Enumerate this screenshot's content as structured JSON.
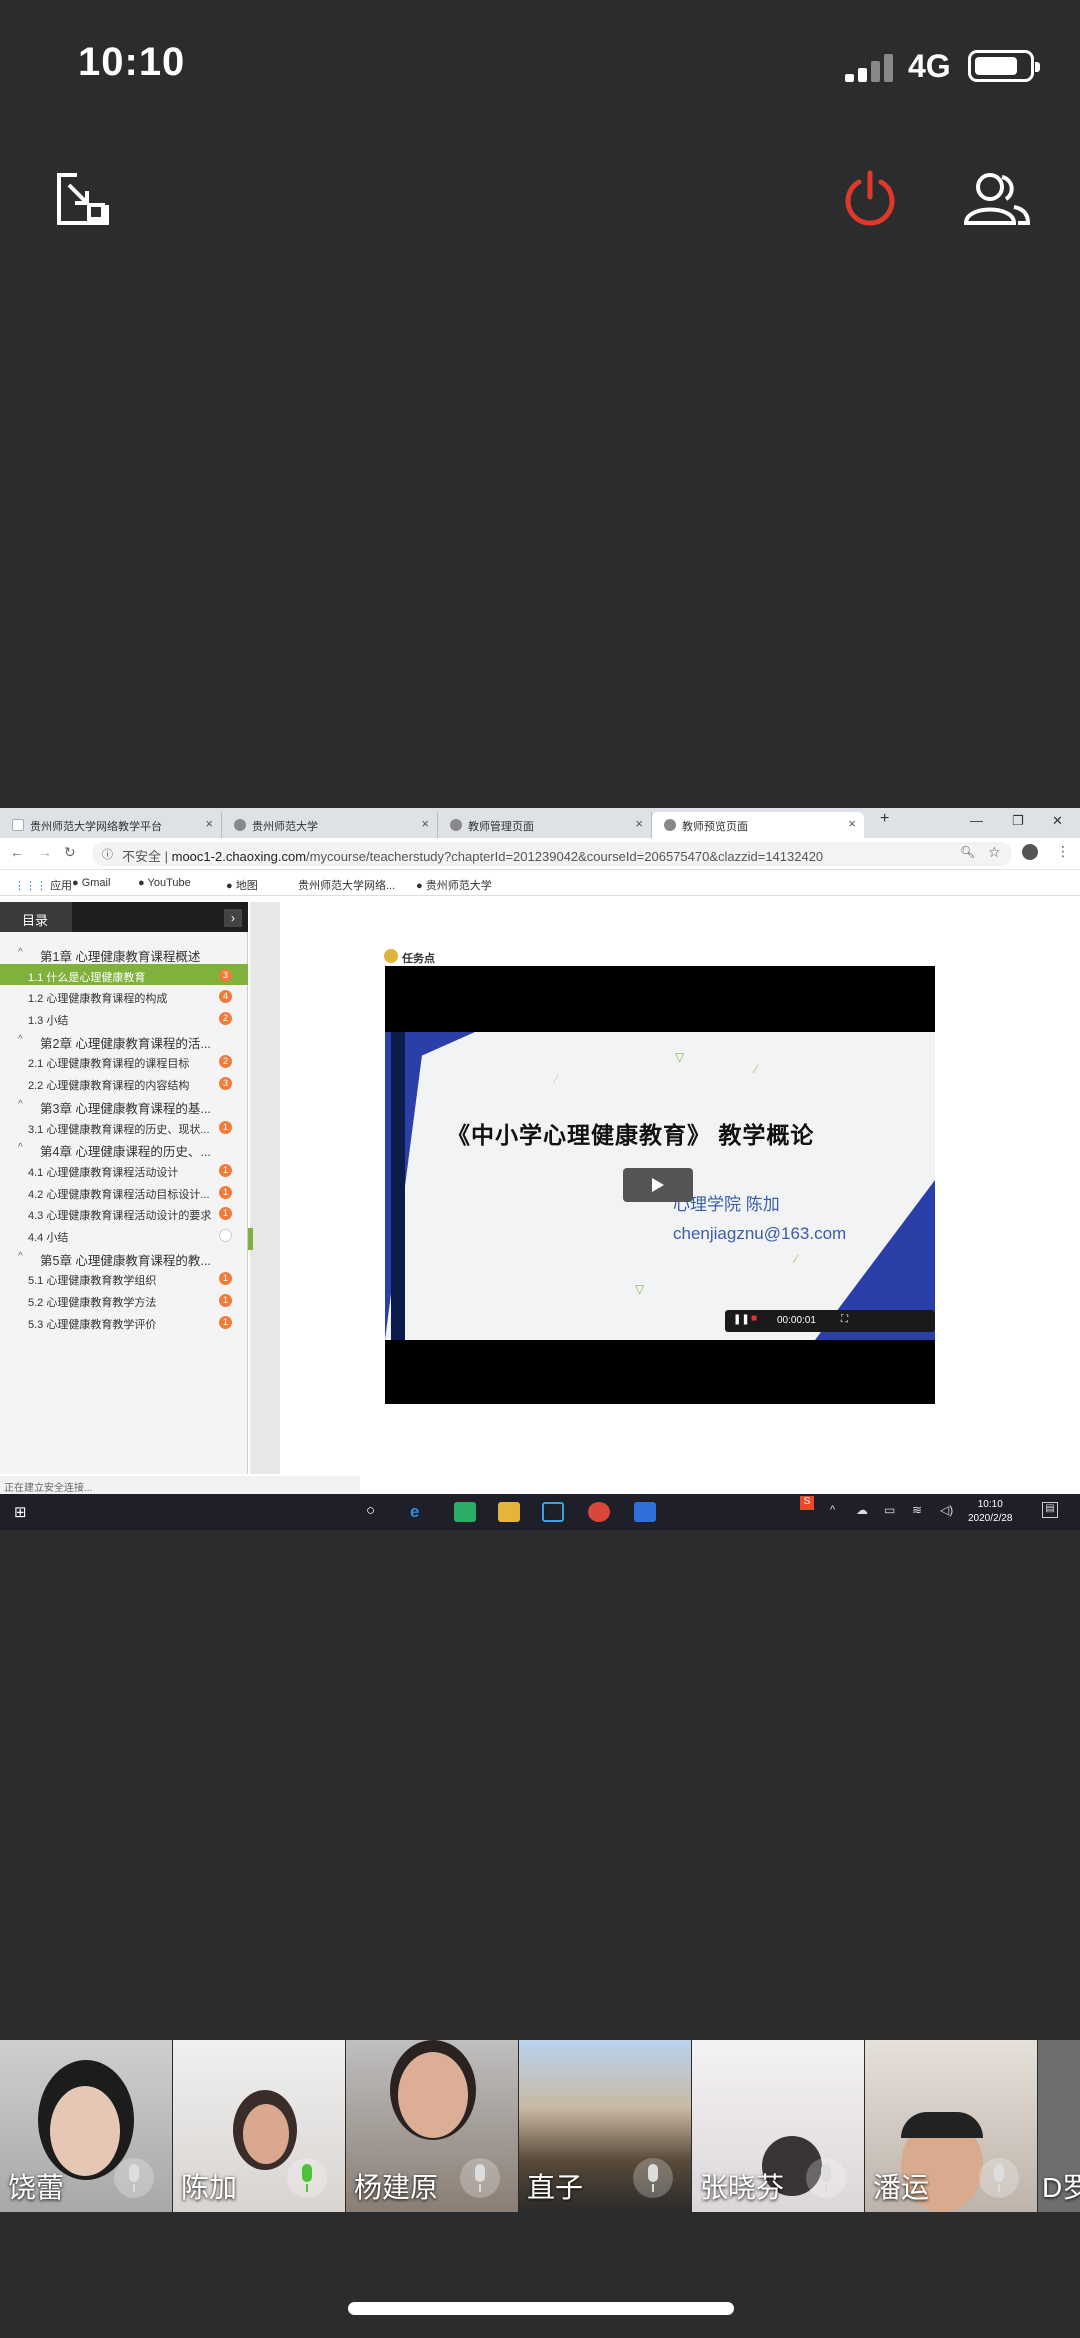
{
  "status_bar": {
    "time": "10:10",
    "network": "4G"
  },
  "meeting_controls": {
    "minimize": "minimize-icon",
    "end": "power-icon",
    "participants": "participants-icon",
    "end_color": "#e0392b"
  },
  "browser": {
    "tabs": [
      "贵州师范大学网络教学平台",
      "贵州师范大学",
      "教师管理页面",
      "教师预览页面"
    ],
    "new_tab": "+",
    "security": "不安全",
    "url_domain": "mooc1-2.chaoxing.com",
    "url_path": "/mycourse/teacherstudy?chapterId=201239042&courseId=206575470&clazzid=14132420",
    "bookmarks": [
      "应用",
      "Gmail",
      "YouTube",
      "地图",
      "贵州师范大学网络...",
      "贵州师范大学"
    ],
    "status_text": "正在建立安全连接..."
  },
  "sidebar": {
    "title": "目录",
    "items": [
      {
        "kind": "ch",
        "label": "第1章 心理健康教育课程概述",
        "badge": ""
      },
      {
        "kind": "sec",
        "label": "1.1 什么是心理健康教育",
        "badge": "3",
        "active": true
      },
      {
        "kind": "sec",
        "label": "1.2 心理健康教育课程的构成",
        "badge": "4"
      },
      {
        "kind": "sec",
        "label": "1.3 小结",
        "badge": "2"
      },
      {
        "kind": "ch",
        "label": "第2章 心理健康教育课程的活...",
        "badge": ""
      },
      {
        "kind": "sec",
        "label": "2.1 心理健康教育课程的课程目标",
        "badge": "2"
      },
      {
        "kind": "sec",
        "label": "2.2 心理健康教育课程的内容结构",
        "badge": "3"
      },
      {
        "kind": "ch",
        "label": "第3章 心理健康教育课程的基...",
        "badge": ""
      },
      {
        "kind": "sec",
        "label": "3.1 心理健康教育课程的历史、现状...",
        "badge": "1"
      },
      {
        "kind": "ch",
        "label": "第4章 心理健康课程的历史、...",
        "badge": ""
      },
      {
        "kind": "sec",
        "label": "4.1 心理健康教育课程活动设计",
        "badge": "1"
      },
      {
        "kind": "sec",
        "label": "4.2 心理健康教育课程活动目标设计...",
        "badge": "1"
      },
      {
        "kind": "sec",
        "label": "4.3 心理健康教育课程活动设计的要求",
        "badge": "1"
      },
      {
        "kind": "sec",
        "label": "4.4 小结",
        "badge": "empty"
      },
      {
        "kind": "ch",
        "label": "第5章 心理健康教育课程的教...",
        "badge": ""
      },
      {
        "kind": "sec",
        "label": "5.1 心理健康教育教学组织",
        "badge": "1"
      },
      {
        "kind": "sec",
        "label": "5.2 心理健康教育教学方法",
        "badge": "1"
      },
      {
        "kind": "sec",
        "label": "5.3 心理健康教育教学评价",
        "badge": "1"
      }
    ]
  },
  "content": {
    "task_label": "任务点",
    "slide_title": "《中小学心理健康教育》 教学概论",
    "slide_author": "心理学院 陈加",
    "slide_email": "chenjiagznu@163.com",
    "video_time": "00:00:01"
  },
  "taskbar": {
    "time": "10:10",
    "date": "2020/2/28"
  },
  "participants": [
    {
      "name": "饶蕾",
      "mic_active": false
    },
    {
      "name": "陈加",
      "mic_active": true
    },
    {
      "name": "杨建原",
      "mic_active": false
    },
    {
      "name": "直子",
      "mic_active": false
    },
    {
      "name": "张晓芬",
      "mic_active": false
    },
    {
      "name": "潘运",
      "mic_active": false
    },
    {
      "name": "D罗",
      "mic_active": false
    }
  ]
}
